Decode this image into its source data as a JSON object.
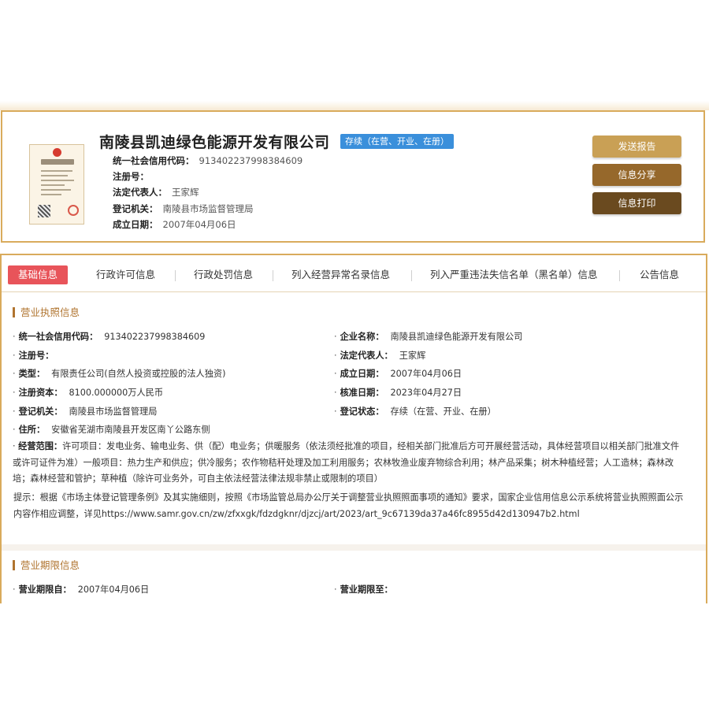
{
  "company": {
    "name": "南陵县凯迪绿色能源开发有限公司",
    "status": "存续（在营、开业、在册）",
    "credit_code_label": "统一社会信用代码：",
    "credit_code": "913402237998384609",
    "reg_no_label": "注册号：",
    "reg_no": "",
    "legal_rep_label": "法定代表人：",
    "legal_rep": "王家辉",
    "authority_label": "登记机关：",
    "authority": "南陵县市场监督管理局",
    "founded_label": "成立日期：",
    "founded": "2007年04月06日"
  },
  "actions": {
    "send_report": "发送报告",
    "share": "信息分享",
    "print": "信息打印"
  },
  "tabs": [
    {
      "label": "基础信息",
      "active": true
    },
    {
      "label": "行政许可信息"
    },
    {
      "label": "行政处罚信息"
    },
    {
      "label": "列入经营异常名录信息"
    },
    {
      "label": "列入严重违法失信名单（黑名单）信息"
    },
    {
      "label": "公告信息"
    }
  ],
  "license_section": {
    "title": "营业执照信息",
    "fields": {
      "credit_code": {
        "label": "统一社会信用代码：",
        "value": "913402237998384609"
      },
      "company_name": {
        "label": "企业名称：",
        "value": "南陵县凯迪绿色能源开发有限公司"
      },
      "reg_no": {
        "label": "注册号：",
        "value": ""
      },
      "legal_rep": {
        "label": "法定代表人：",
        "value": "王家辉"
      },
      "type": {
        "label": "类型：",
        "value": "有限责任公司(自然人投资或控股的法人独资)"
      },
      "founded": {
        "label": "成立日期：",
        "value": "2007年04月06日"
      },
      "capital": {
        "label": "注册资本：",
        "value": "8100.000000万人民币"
      },
      "approved": {
        "label": "核准日期：",
        "value": "2023年04月27日"
      },
      "authority": {
        "label": "登记机关：",
        "value": "南陵县市场监督管理局"
      },
      "reg_status": {
        "label": "登记状态：",
        "value": "存续（在营、开业、在册）"
      },
      "address": {
        "label": "住所：",
        "value": "安徽省芜湖市南陵县开发区南丫公路东侧"
      }
    },
    "scope_label": "经营范围：",
    "scope_value": "许可项目：发电业务、输电业务、供（配）电业务；供暖服务（依法须经批准的项目，经相关部门批准后方可开展经营活动，具体经营项目以相关部门批准文件或许可证件为准）一般项目：热力生产和供应；供冷服务；农作物秸秆处理及加工利用服务；农林牧渔业废弃物综合利用；林产品采集；树木种植经营；人工造林；森林改培；森林经营和管护；草种植（除许可业务外，可自主依法经营法律法规非禁止或限制的项目）",
    "notice": "提示：根据《市场主体登记管理条例》及其实施细则，按照《市场监管总局办公厅关于调整营业执照照面事项的通知》要求，国家企业信用信息公示系统将营业执照照面公示内容作相应调整，详见https://www.samr.gov.cn/zw/zfxxgk/fdzdgknr/djzcj/art/2023/art_9c67139da37a46fc8955d42d130947b2.html"
  },
  "term_section": {
    "title": "营业期限信息",
    "from_label": "营业期限自：",
    "from_value": "2007年04月06日",
    "to_label": "营业期限至：",
    "to_value": ""
  },
  "colors": {
    "gold_border": "#d9ab5c",
    "btn_send": "#c9a055",
    "btn_share": "#96682b",
    "btn_print": "#6a4a1f",
    "tab_active": "#e8545a",
    "badge": "#3a8fdb",
    "section_title": "#b0742f"
  }
}
